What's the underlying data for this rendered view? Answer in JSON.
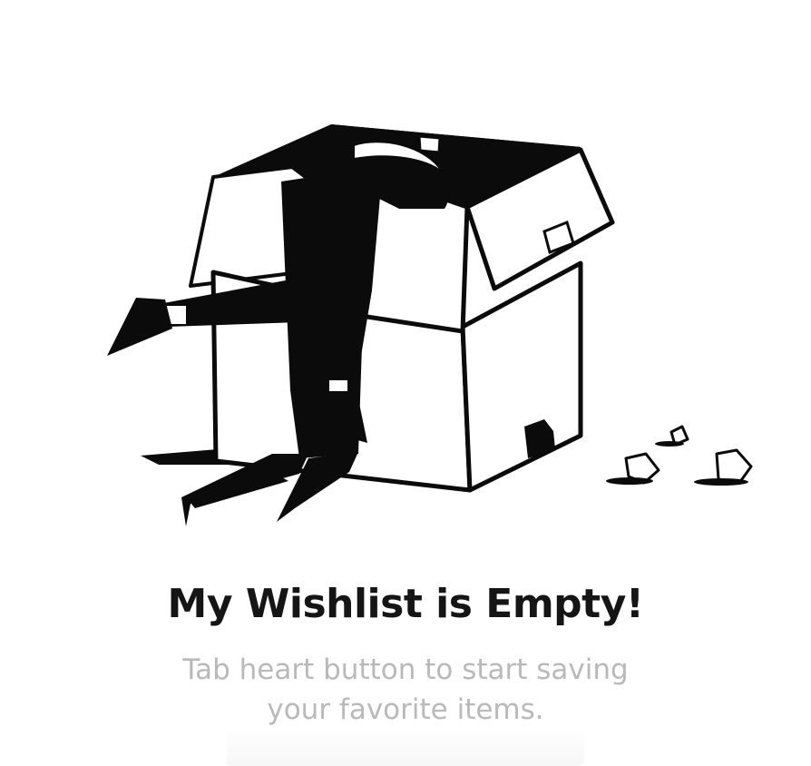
{
  "empty_state": {
    "illustration_icon": "person-in-box-icon",
    "title": "My Wishlist is Empty!",
    "subtitle_line1": "Tab heart button to start saving",
    "subtitle_line2": "your favorite items."
  },
  "colors": {
    "ink": "#0b0b0b",
    "title": "#151515",
    "subtitle": "#b9b9b9",
    "background": "#ffffff"
  }
}
